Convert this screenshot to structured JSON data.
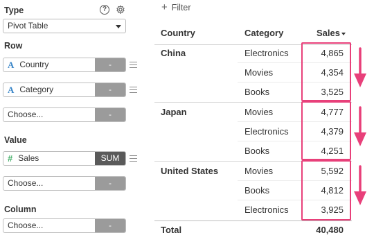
{
  "config": {
    "type_label": "Type",
    "type_value": "Pivot Table",
    "row_label": "Row",
    "row_fields": [
      {
        "name": "Country",
        "agg": "-"
      },
      {
        "name": "Category",
        "agg": "-"
      },
      {
        "name": "Choose...",
        "agg": "-"
      }
    ],
    "value_label": "Value",
    "value_fields": [
      {
        "name": "Sales",
        "agg": "SUM"
      },
      {
        "name": "Choose...",
        "agg": "-"
      }
    ],
    "column_label": "Column",
    "column_fields": [
      {
        "name": "Choose...",
        "agg": "-"
      }
    ]
  },
  "filter_label": "Filter",
  "table": {
    "headers": {
      "country": "Country",
      "category": "Category",
      "sales": "Sales"
    },
    "groups": [
      {
        "country": "China",
        "rows": [
          {
            "category": "Electronics",
            "sales": "4,865"
          },
          {
            "category": "Movies",
            "sales": "4,354"
          },
          {
            "category": "Books",
            "sales": "3,525"
          }
        ]
      },
      {
        "country": "Japan",
        "rows": [
          {
            "category": "Movies",
            "sales": "4,777"
          },
          {
            "category": "Electronics",
            "sales": "4,379"
          },
          {
            "category": "Books",
            "sales": "4,251"
          }
        ]
      },
      {
        "country": "United States",
        "rows": [
          {
            "category": "Movies",
            "sales": "5,592"
          },
          {
            "category": "Books",
            "sales": "4,812"
          },
          {
            "category": "Electronics",
            "sales": "3,925"
          }
        ]
      }
    ],
    "total_label": "Total",
    "total_value": "40,480"
  },
  "colors": {
    "highlight": "#e8407a",
    "string_type": "#3a86c8",
    "number_type": "#46b06a"
  },
  "icons": {
    "help": "help-icon",
    "settings": "gear-icon",
    "filter": "plus-icon",
    "drag": "drag-handle-icon",
    "sort": "sort-desc-icon",
    "arrow": "arrow-down-icon"
  }
}
